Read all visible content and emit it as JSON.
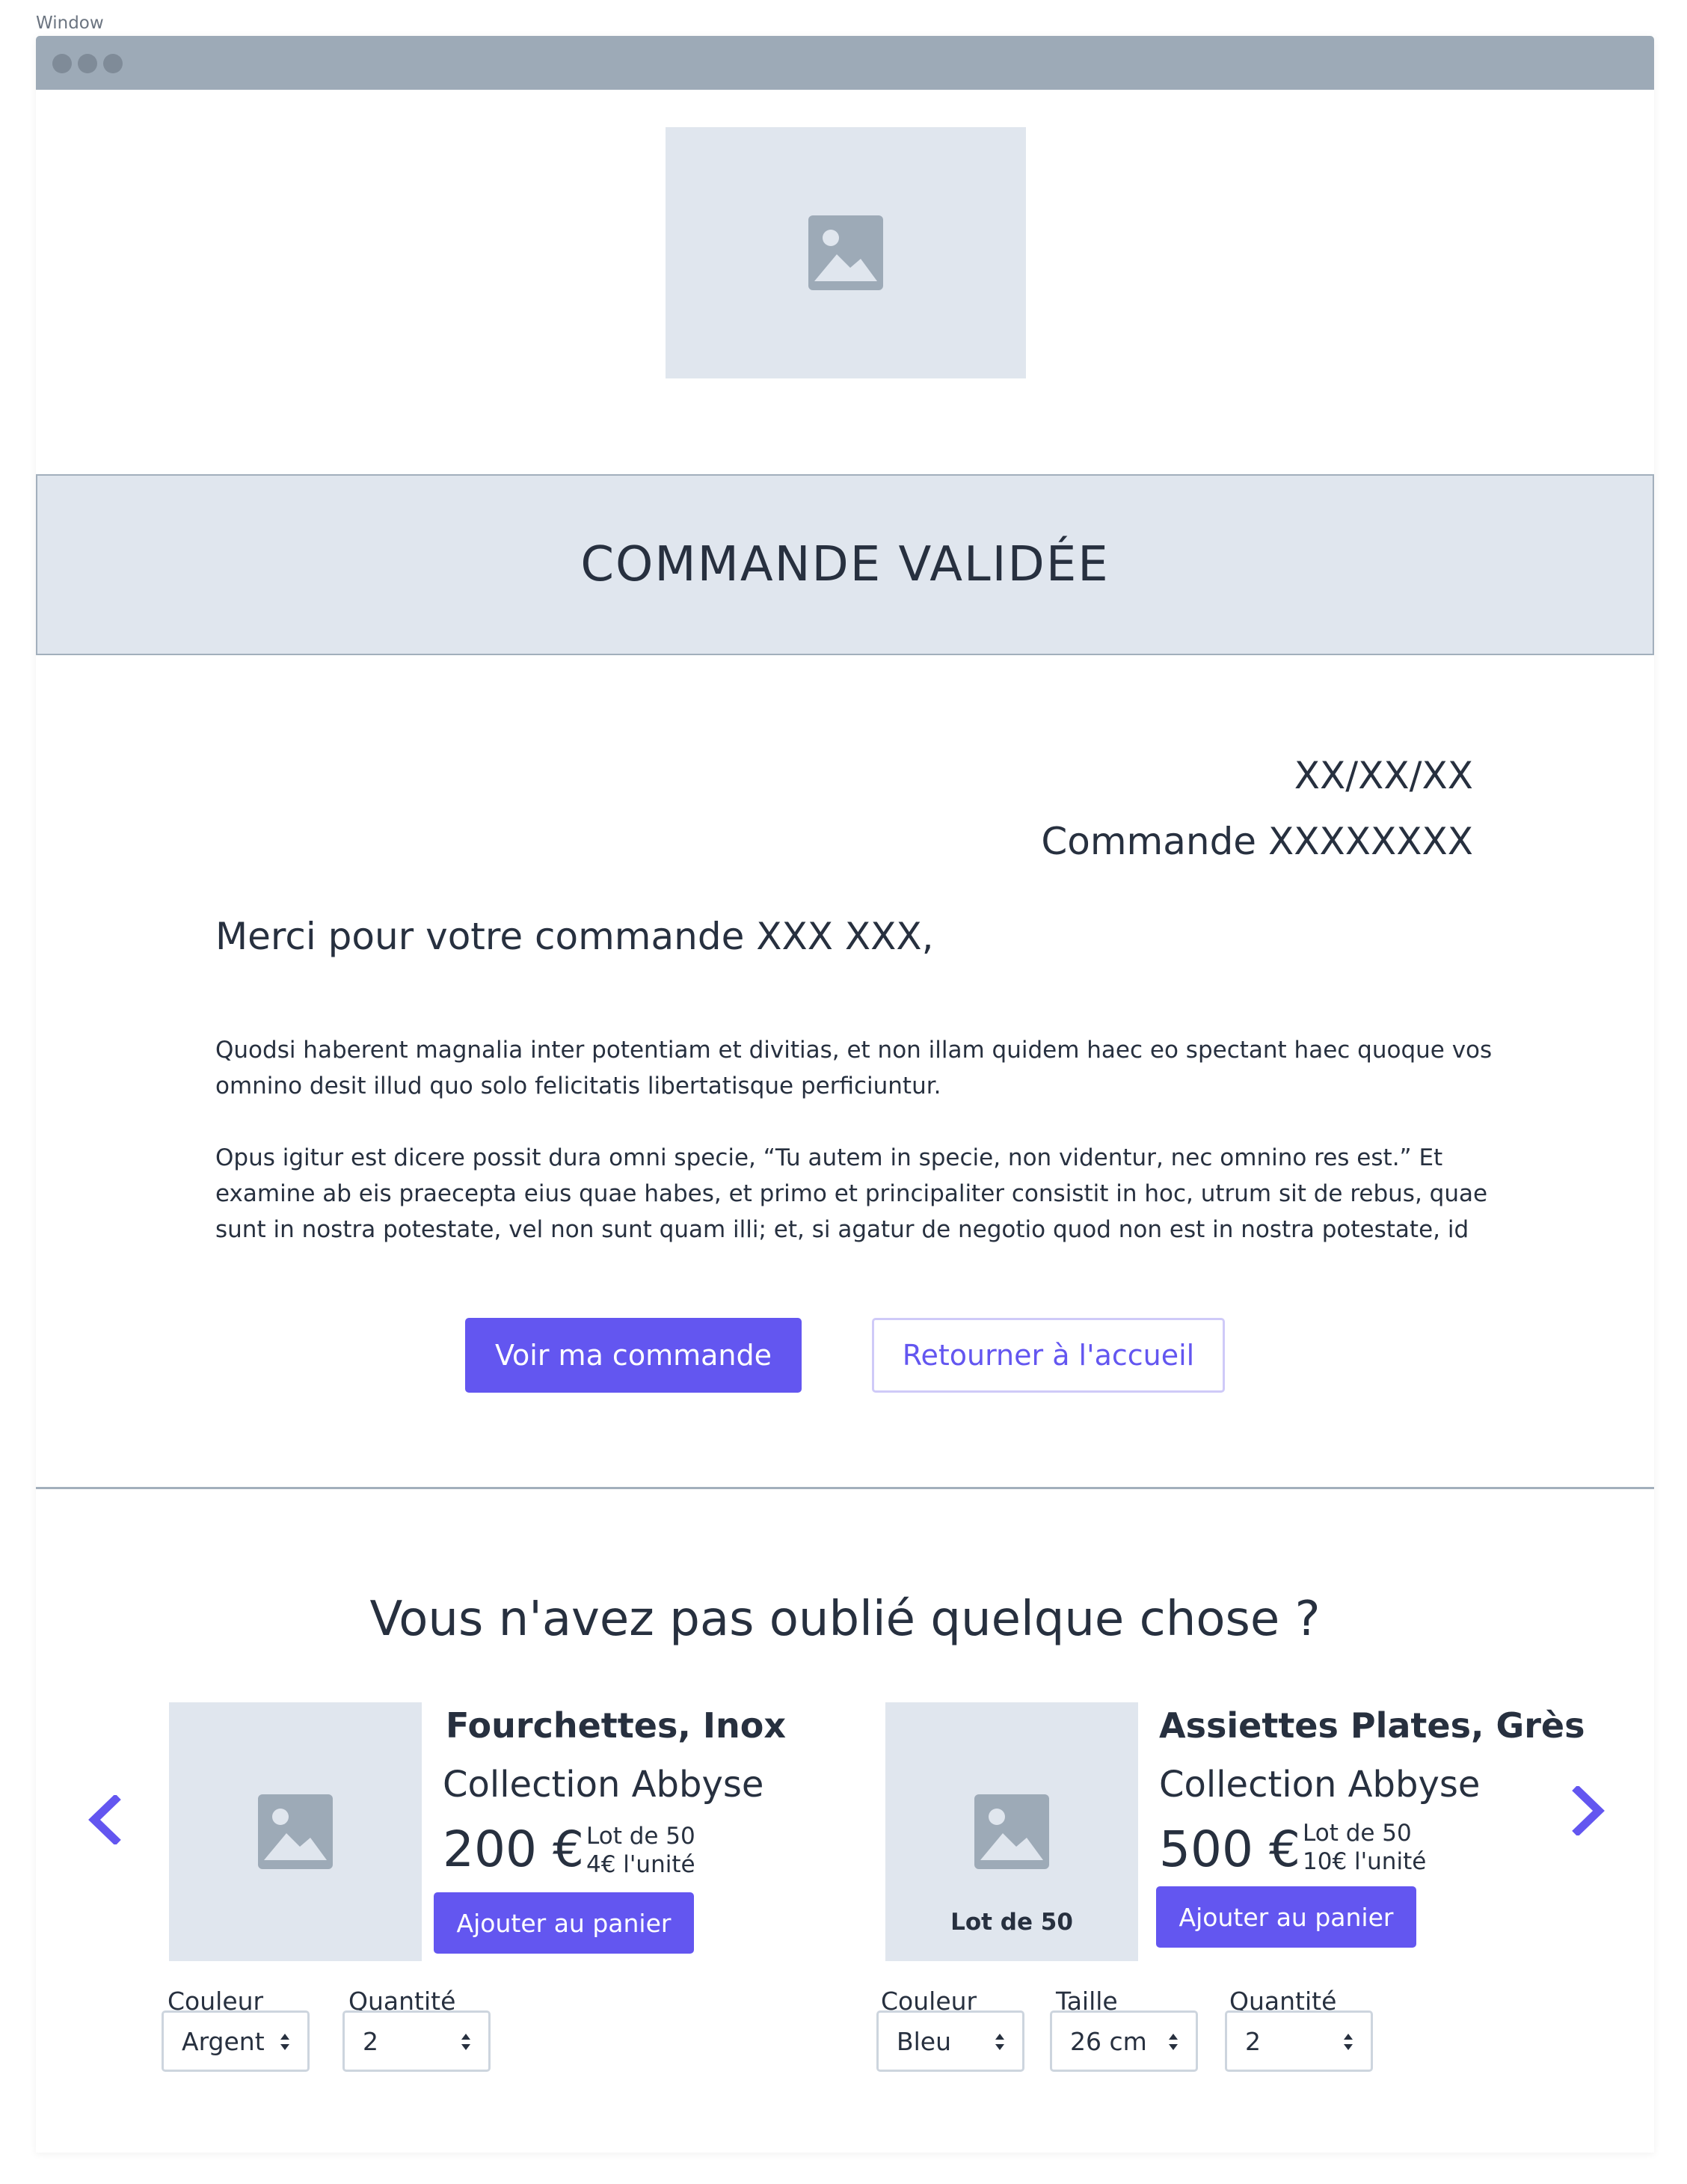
{
  "window": {
    "label": "Window"
  },
  "header": {
    "logo_icon": "image-icon"
  },
  "banner": {
    "title": "COMMANDE VALIDÉE"
  },
  "order": {
    "date": "XX/XX/XX",
    "number": "Commande XXXXXXXX",
    "greeting": "Merci pour votre commande XXX XXX,",
    "paragraphs": [
      [
        "Quodsi haberent magnalia inter potentiam et divitias, et non illam quidem haec eo spectant haec quoque vos",
        "omnino desit illud quo solo felicitatis libertatisque perficiuntur."
      ],
      [
        "Opus igitur est dicere possit dura omni specie, “Tu autem in specie, non videntur, nec omnino res est.” Et",
        "examine ab eis praecepta eius quae habes, et primo et principaliter consistit in hoc, utrum sit de rebus, quae",
        "sunt in nostra potestate, vel non sunt quam illi; et, si agatur de negotio quod non est in nostra potestate, id"
      ]
    ],
    "view_button": "Voir ma commande",
    "home_button": "Retourner à l'accueil"
  },
  "suggestions": {
    "title": "Vous n'avez pas oublié quelque chose ?",
    "prev_icon": "chevron-left-icon",
    "next_icon": "chevron-right-icon",
    "colors": {
      "accent": "#6356f0",
      "placeholder": "#e0e6ee",
      "text": "#27303f"
    },
    "products": [
      {
        "name": "Fourchettes, Inox",
        "collection": "Collection Abbyse",
        "price": "200 €",
        "lot": "Lot de 50",
        "unit": "4€ l'unité",
        "add_button": "Ajouter au panier",
        "color_label": "Couleur",
        "color_value": "Argent",
        "qty_label": "Quantité",
        "qty_value": "2"
      },
      {
        "name": "Assiettes Plates, Grès",
        "collection": "Collection Abbyse",
        "price": "500 €",
        "lot": "Lot de 50",
        "unit": "10€ l'unité",
        "image_caption": "Lot de 50",
        "add_button": "Ajouter au panier",
        "color_label": "Couleur",
        "color_value": "Bleu",
        "size_label": "Taille",
        "size_value": "26 cm",
        "qty_label": "Quantité",
        "qty_value": "2"
      }
    ]
  }
}
